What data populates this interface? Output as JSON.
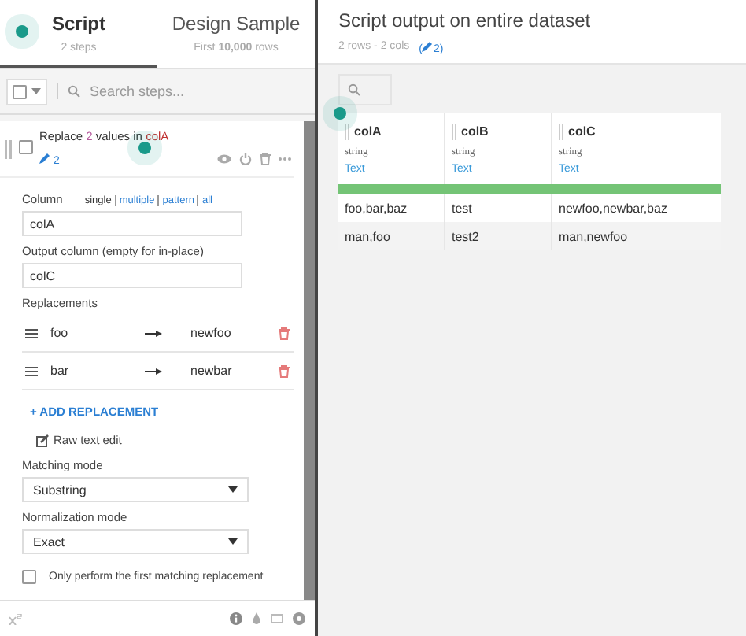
{
  "tabs": [
    {
      "label": "Script",
      "sub": "2 steps",
      "selected": true
    },
    {
      "label": "Design Sample",
      "sub_parts": [
        {
          "text": "First ",
          "kind": "plain"
        },
        {
          "text": "10,000",
          "kind": "strong"
        },
        {
          "text": " rows",
          "kind": "plain"
        }
      ],
      "selected": false
    }
  ],
  "steps_search": {
    "placeholder": "Search steps..."
  },
  "step": {
    "title": [
      {
        "text": "Replace ",
        "kind": "plain"
      },
      {
        "text": "2",
        "kind": "count"
      },
      {
        "text": " values in ",
        "kind": "plain"
      },
      {
        "text": "colA",
        "kind": "column"
      }
    ],
    "checked": false,
    "edits": "2",
    "column_label": "Column",
    "column_modes": [
      {
        "label": "single",
        "selected": true
      },
      {
        "label": "multiple",
        "selected": false
      },
      {
        "label": "pattern",
        "selected": false
      },
      {
        "label": "all",
        "selected": false
      }
    ],
    "column_value": "colA",
    "output_label": "Output column (empty for in-place)",
    "output_value": "colC",
    "replacements_label": "Replacements",
    "replacements": [
      {
        "from": "foo",
        "to": "newfoo"
      },
      {
        "from": "bar",
        "to": "newbar"
      }
    ],
    "add_label": "+ ADD REPLACEMENT",
    "raw_edit": "Raw text edit",
    "matching_label": "Matching mode",
    "matching_value": "Substring",
    "normalization_label": "Normalization mode",
    "normalization_value": "Exact",
    "first_only": {
      "label": "Only perform the first matching replacement",
      "checked": false
    }
  },
  "output": {
    "title": "Script output on entire dataset",
    "summary": "2 rows - 2 cols",
    "edits_open": "(",
    "edits": "2)",
    "columns": [
      {
        "name": "colA",
        "type": "string",
        "meaning": "Text"
      },
      {
        "name": "colB",
        "type": "string",
        "meaning": "Text"
      },
      {
        "name": "colC",
        "type": "string",
        "meaning": "Text"
      }
    ],
    "rows": [
      [
        "foo,bar,baz",
        "test",
        "newfoo,newbar,baz"
      ],
      [
        "man,foo",
        "test2",
        "man,newfoo"
      ]
    ]
  }
}
